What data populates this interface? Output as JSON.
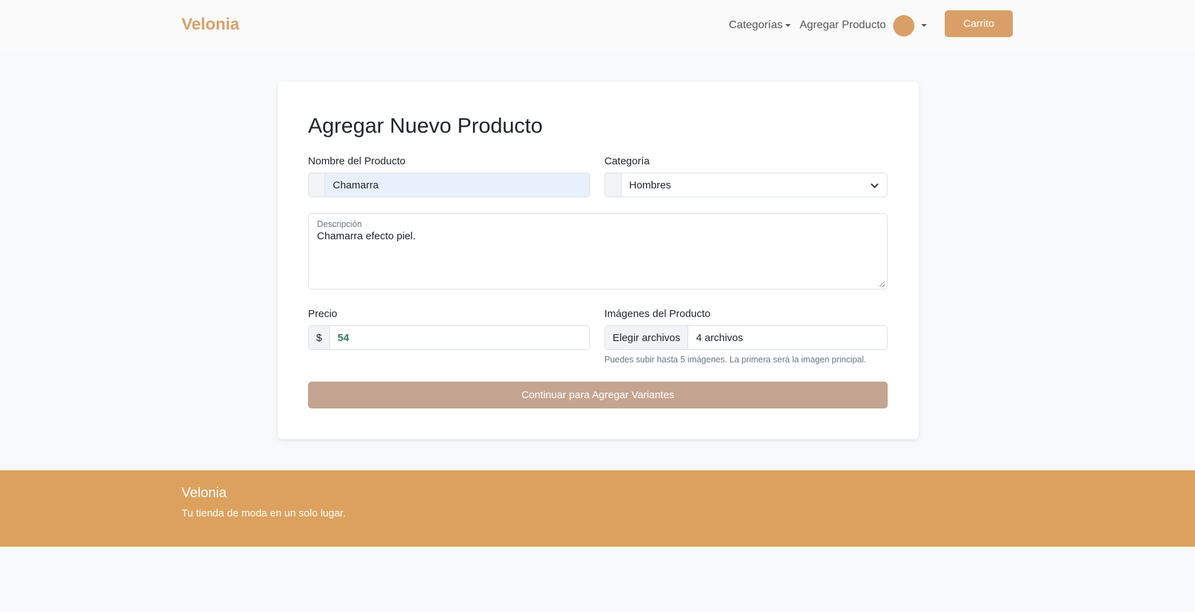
{
  "nav": {
    "brand": "Velonia",
    "categories_label": "Categorías",
    "add_product_label": "Agregar Producto",
    "cart_label": "Carrito"
  },
  "form": {
    "title": "Agregar Nuevo Producto",
    "name_label": "Nombre del Producto",
    "name_value": "Chamarra",
    "category_label": "Categoría",
    "category_value": "Hombres",
    "description_label": "Descripción",
    "description_value": "Chamarra efecto piel.",
    "price_label": "Precio",
    "price_prefix": "$",
    "price_value": "54",
    "images_label": "Imágenes del Producto",
    "images_button": "Elegir archivos",
    "images_value": "4 archivos",
    "images_help": "Puedes subir hasta 5 imágenes. La primera será la imagen principal.",
    "submit_label": "Continuar para Agregar Variantes"
  },
  "footer": {
    "brand": "Velonia",
    "tagline": "Tu tienda de moda en un solo lugar."
  },
  "colors": {
    "brand": "#d8a068",
    "footer_bg": "#dca15e",
    "submit_bg": "#c4a490",
    "price_text": "#2e7d57"
  }
}
